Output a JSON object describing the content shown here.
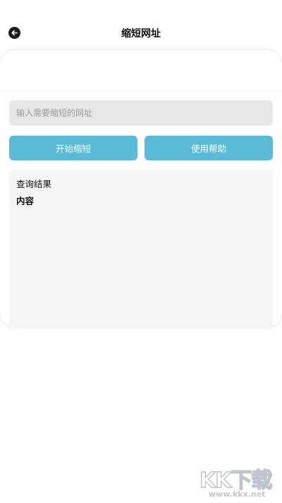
{
  "header": {
    "title": "缩短网址",
    "back_icon": "arrow-left-icon"
  },
  "form": {
    "url_placeholder": "输入需要缩短的网址",
    "url_value": ""
  },
  "actions": {
    "start_label": "开始缩短",
    "help_label": "使用帮助"
  },
  "result": {
    "title": "查询结果",
    "content": "内容"
  },
  "watermark": {
    "logo_text": "KK下载",
    "url": "www.kkx.net"
  },
  "colors": {
    "accent": "#5bbad6",
    "input_bg": "#e7e7e7",
    "result_bg": "#f5f5f5"
  }
}
